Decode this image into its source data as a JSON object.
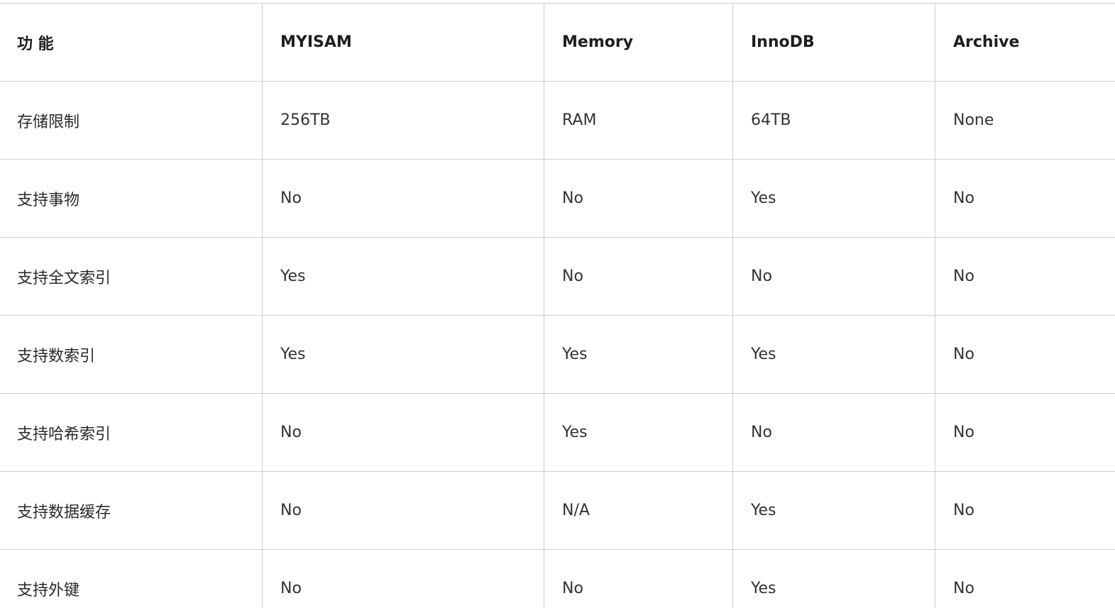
{
  "table": {
    "headers": [
      "功 能",
      "MYISAM",
      "Memory",
      "InnoDB",
      "Archive"
    ],
    "rows": [
      [
        "存储限制",
        "256TB",
        "RAM",
        "64TB",
        "None"
      ],
      [
        "支持事物",
        "No",
        "No",
        "Yes",
        "No"
      ],
      [
        "支持全文索引",
        "Yes",
        "No",
        "No",
        "No"
      ],
      [
        "支持数索引",
        "Yes",
        "Yes",
        "Yes",
        "No"
      ],
      [
        "支持哈希索引",
        "No",
        "Yes",
        "No",
        "No"
      ],
      [
        "支持数据缓存",
        "No",
        "N/A",
        "Yes",
        "No"
      ],
      [
        "支持外键",
        "No",
        "No",
        "Yes",
        "No"
      ]
    ]
  },
  "colors": {
    "border": "#cfcfcf",
    "text": "#333333",
    "header_text": "#1e1e1e",
    "background": "#ffffff"
  }
}
